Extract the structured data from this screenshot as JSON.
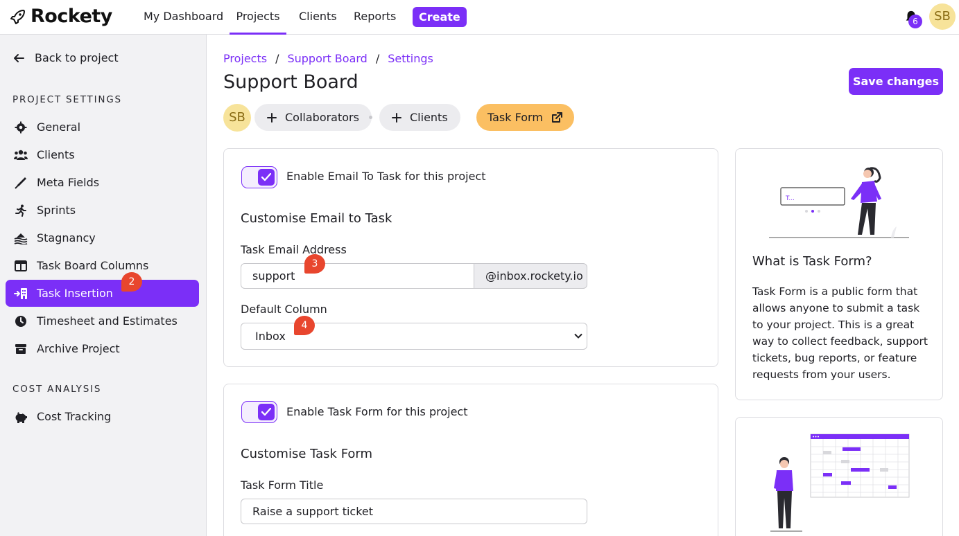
{
  "app": {
    "name": "Rockety"
  },
  "nav": {
    "items": [
      {
        "label": "My Dashboard"
      },
      {
        "label": "Projects"
      },
      {
        "label": "Clients"
      },
      {
        "label": "Reports"
      }
    ],
    "create_label": "Create",
    "notifications_count": "6",
    "user_initials": "SB"
  },
  "sidebar": {
    "back_label": "Back to project",
    "project_settings_heading": "PROJECT SETTINGS",
    "items": [
      {
        "label": "General",
        "icon": "gear-icon"
      },
      {
        "label": "Clients",
        "icon": "users-icon"
      },
      {
        "label": "Meta Fields",
        "icon": "pen-icon"
      },
      {
        "label": "Sprints",
        "icon": "running-icon"
      },
      {
        "label": "Stagnancy",
        "icon": "water-icon"
      },
      {
        "label": "Task Board Columns",
        "icon": "columns-icon"
      },
      {
        "label": "Task Insertion",
        "icon": "insert-icon"
      },
      {
        "label": "Timesheet and Estimates",
        "icon": "clock-icon"
      },
      {
        "label": "Archive Project",
        "icon": "archive-icon"
      }
    ],
    "cost_heading": "COST ANALYSIS",
    "cost_items": [
      {
        "label": "Cost Tracking",
        "icon": "piggy-bank-icon"
      }
    ],
    "active_badge": "2"
  },
  "breadcrumb": {
    "items": [
      "Projects",
      "Support Board",
      "Settings"
    ],
    "separator": "/"
  },
  "page": {
    "title": "Support Board",
    "save_label": "Save changes",
    "owner_initials": "SB",
    "collaborators_label": "Collaborators",
    "clients_label": "Clients",
    "task_form_label": "Task Form"
  },
  "email_to_task": {
    "toggle_label": "Enable Email To Task for this project",
    "enabled": true,
    "section_title": "Customise Email to Task",
    "email_label": "Task Email Address",
    "email_value": "support",
    "email_domain": "@inbox.rockety.io",
    "email_badge": "3",
    "column_label": "Default Column",
    "column_value": "Inbox",
    "column_badge": "4"
  },
  "task_form": {
    "toggle_label": "Enable Task Form for this project",
    "enabled": true,
    "section_title": "Customise Task Form",
    "title_label": "Task Form Title",
    "title_value": "Raise a support ticket"
  },
  "info": {
    "title": "What is Task Form?",
    "body": "Task Form is a public form that allows anyone to submit a task to your project. This is a great way to collect feedback, support tickets, bug reports, or feature requests from your users."
  },
  "colors": {
    "accent": "#7b2ff7",
    "badge": "#e8462e",
    "orange": "#fbbf62"
  }
}
